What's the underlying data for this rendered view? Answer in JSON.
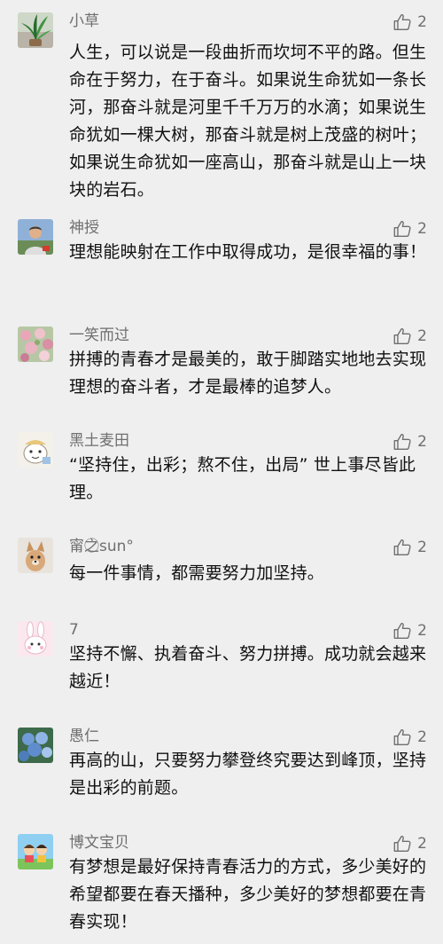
{
  "comments": [
    {
      "username": "小草",
      "likes": "2",
      "avatar_icon": "plant-avatar-icon",
      "text": "人生，可以说是一段曲折而坎坷不平的路。但生命在于努力，在于奋斗。如果说生命犹如一条长河，那奋斗就是河里千千万万的水滴；如果说生命犹如一棵大树，那奋斗就是树上茂盛的树叶；如果说生命犹如一座高山，那奋斗就是山上一块块的岩石。"
    },
    {
      "username": "神授",
      "likes": "2",
      "avatar_icon": "person-avatar-icon",
      "text": "理想能映射在工作中取得成功，是很幸福的事！"
    },
    {
      "username": "一笑而过",
      "likes": "2",
      "avatar_icon": "flowers-avatar-icon",
      "text": "拼搏的青春才是最美的，敢于脚踏实地地去实现理想的奋斗者，才是最棒的追梦人。"
    },
    {
      "username": "黑土麦田",
      "likes": "2",
      "avatar_icon": "cartoon-avatar-icon",
      "text": "“坚持住，出彩；熬不住，出局” 世上事尽皆此理。"
    },
    {
      "username": "甯之⃝sun°",
      "likes": "2",
      "avatar_icon": "dog-avatar-icon",
      "text": "每一件事情，都需要努力加坚持。"
    },
    {
      "username": "7",
      "likes": "2",
      "avatar_icon": "rabbit-avatar-icon",
      "text": "坚持不懈、执着奋斗、努力拼搏。成功就会越来越近！"
    },
    {
      "username": "愚仁",
      "likes": "2",
      "avatar_icon": "hydrangea-avatar-icon",
      "text": "再高的山，只要努力攀登终究要达到峰顶，坚持是出彩的前题。"
    },
    {
      "username": "博文宝贝",
      "likes": "2",
      "avatar_icon": "kids-avatar-icon",
      "text": "有梦想是最好保持青春活力的方式，多少美好的希望都要在春天播种，多少美好的梦想都要在青春实现！"
    }
  ],
  "colors": {
    "background": "#efefef",
    "meta_text": "#6f6f6f",
    "body_text": "#111111"
  }
}
